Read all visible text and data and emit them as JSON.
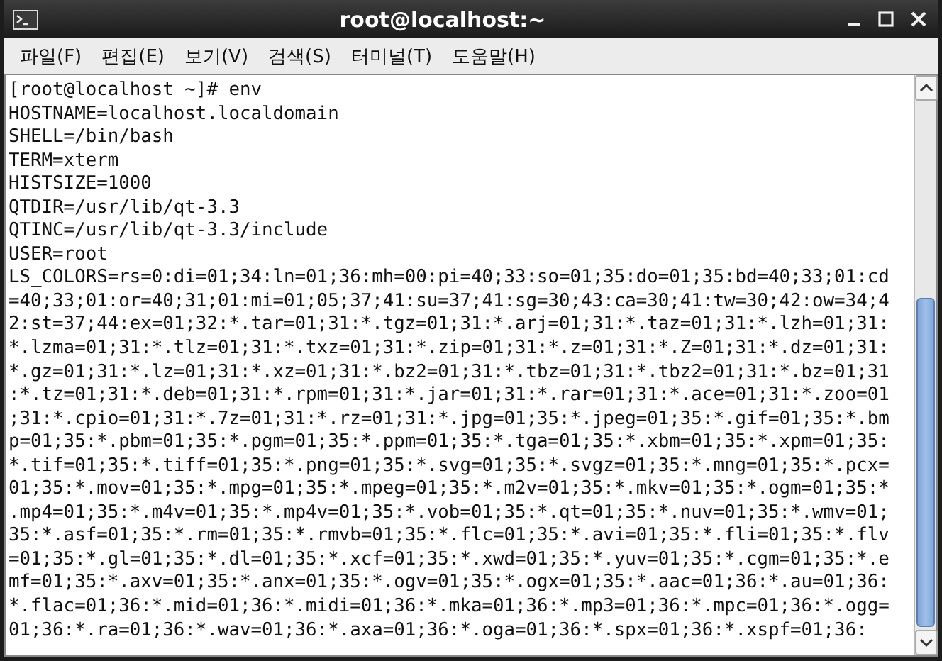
{
  "window": {
    "title": "root@localhost:~"
  },
  "menu": [
    {
      "label": "파일(F)"
    },
    {
      "label": "편집(E)"
    },
    {
      "label": "보기(V)"
    },
    {
      "label": "검색(S)"
    },
    {
      "label": "터미널(T)"
    },
    {
      "label": "도움말(H)"
    }
  ],
  "terminal": {
    "lines": [
      "[root@localhost ~]# env",
      "HOSTNAME=localhost.localdomain",
      "SHELL=/bin/bash",
      "TERM=xterm",
      "HISTSIZE=1000",
      "QTDIR=/usr/lib/qt-3.3",
      "QTINC=/usr/lib/qt-3.3/include",
      "USER=root",
      "LS_COLORS=rs=0:di=01;34:ln=01;36:mh=00:pi=40;33:so=01;35:do=01;35:bd=40;33;01:cd",
      "=40;33;01:or=40;31;01:mi=01;05;37;41:su=37;41:sg=30;43:ca=30;41:tw=30;42:ow=34;4",
      "2:st=37;44:ex=01;32:*.tar=01;31:*.tgz=01;31:*.arj=01;31:*.taz=01;31:*.lzh=01;31:",
      "*.lzma=01;31:*.tlz=01;31:*.txz=01;31:*.zip=01;31:*.z=01;31:*.Z=01;31:*.dz=01;31:",
      "*.gz=01;31:*.lz=01;31:*.xz=01;31:*.bz2=01;31:*.tbz=01;31:*.tbz2=01;31:*.bz=01;31",
      ":*.tz=01;31:*.deb=01;31:*.rpm=01;31:*.jar=01;31:*.rar=01;31:*.ace=01;31:*.zoo=01",
      ";31:*.cpio=01;31:*.7z=01;31:*.rz=01;31:*.jpg=01;35:*.jpeg=01;35:*.gif=01;35:*.bm",
      "p=01;35:*.pbm=01;35:*.pgm=01;35:*.ppm=01;35:*.tga=01;35:*.xbm=01;35:*.xpm=01;35:",
      "*.tif=01;35:*.tiff=01;35:*.png=01;35:*.svg=01;35:*.svgz=01;35:*.mng=01;35:*.pcx=",
      "01;35:*.mov=01;35:*.mpg=01;35:*.mpeg=01;35:*.m2v=01;35:*.mkv=01;35:*.ogm=01;35:*",
      ".mp4=01;35:*.m4v=01;35:*.mp4v=01;35:*.vob=01;35:*.qt=01;35:*.nuv=01;35:*.wmv=01;",
      "35:*.asf=01;35:*.rm=01;35:*.rmvb=01;35:*.flc=01;35:*.avi=01;35:*.fli=01;35:*.flv",
      "=01;35:*.gl=01;35:*.dl=01;35:*.xcf=01;35:*.xwd=01;35:*.yuv=01;35:*.cgm=01;35:*.e",
      "mf=01;35:*.axv=01;35:*.anx=01;35:*.ogv=01;35:*.ogx=01;35:*.aac=01;36:*.au=01;36:",
      "*.flac=01;36:*.mid=01;36:*.midi=01;36:*.mka=01;36:*.mp3=01;36:*.mpc=01;36:*.ogg=",
      "01;36:*.ra=01;36:*.wav=01;36:*.axa=01;36:*.oga=01;36:*.spx=01;36:*.xspf=01;36:"
    ]
  }
}
